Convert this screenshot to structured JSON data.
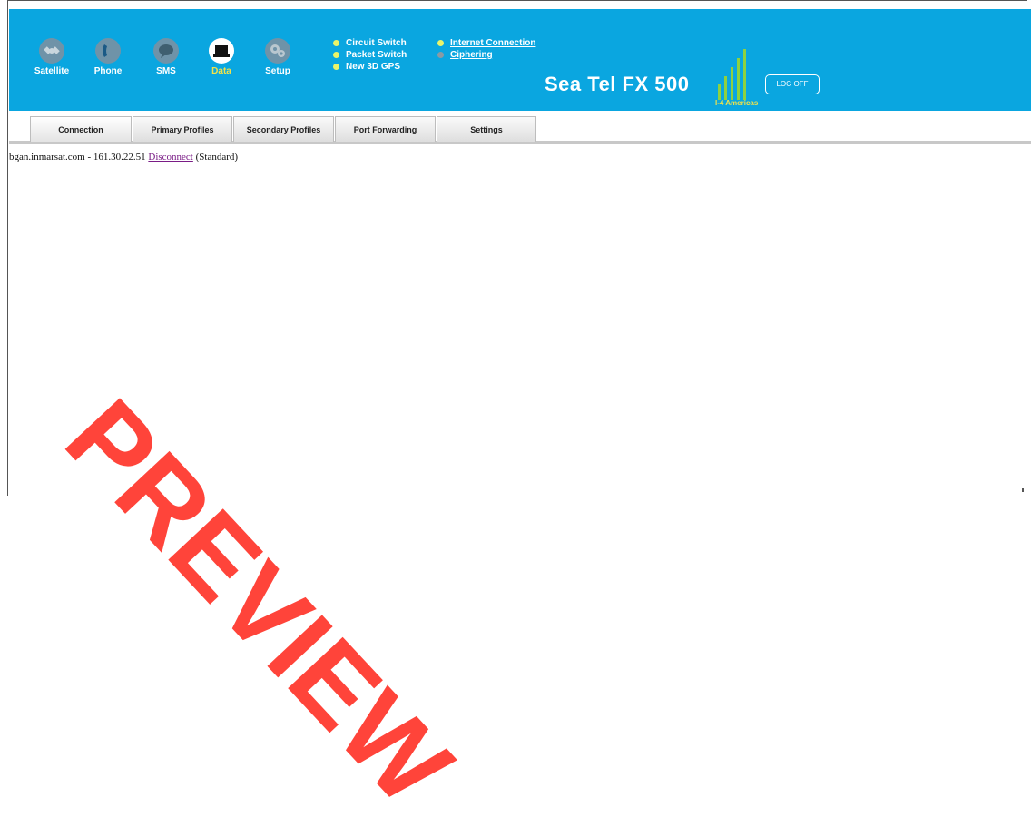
{
  "nav": [
    {
      "label": "Satellite",
      "icon": "satellite-icon",
      "active": false
    },
    {
      "label": "Phone",
      "icon": "phone-icon",
      "active": false
    },
    {
      "label": "SMS",
      "icon": "sms-icon",
      "active": false
    },
    {
      "label": "Data",
      "icon": "laptop-icon",
      "active": true
    },
    {
      "label": "Setup",
      "icon": "gears-icon",
      "active": false
    }
  ],
  "status": {
    "col1": [
      {
        "label": "Circuit Switch",
        "dot": "#e9f46a"
      },
      {
        "label": "Packet Switch",
        "dot": "#e9f46a"
      },
      {
        "label": "New 3D GPS",
        "dot": "#e9f46a"
      }
    ],
    "col2": [
      {
        "label": "Internet Connection",
        "dot": "#e9f46a"
      },
      {
        "label": "Ciphering",
        "dot": "#8a9aa3"
      }
    ]
  },
  "product_name": "Sea Tel  FX 500",
  "signal": {
    "caption": "I-4 Americas",
    "bars": 5
  },
  "logoff_label": "LOG OFF",
  "tabs": [
    {
      "label": "Connection",
      "active": true
    },
    {
      "label": "Primary Profiles",
      "active": false
    },
    {
      "label": "Secondary Profiles",
      "active": false
    },
    {
      "label": "Port Forwarding",
      "active": false
    },
    {
      "label": "Settings",
      "active": false
    }
  ],
  "connection": {
    "host": "bgan.inmarsat.com - 161.30.22.51",
    "action": "Disconnect",
    "mode": "(Standard)"
  },
  "watermark": "PREVIEW",
  "colors": {
    "header_bg": "#0aa6e0",
    "active_label": "#f2e24a",
    "signal_bars": "#8ed13f"
  }
}
